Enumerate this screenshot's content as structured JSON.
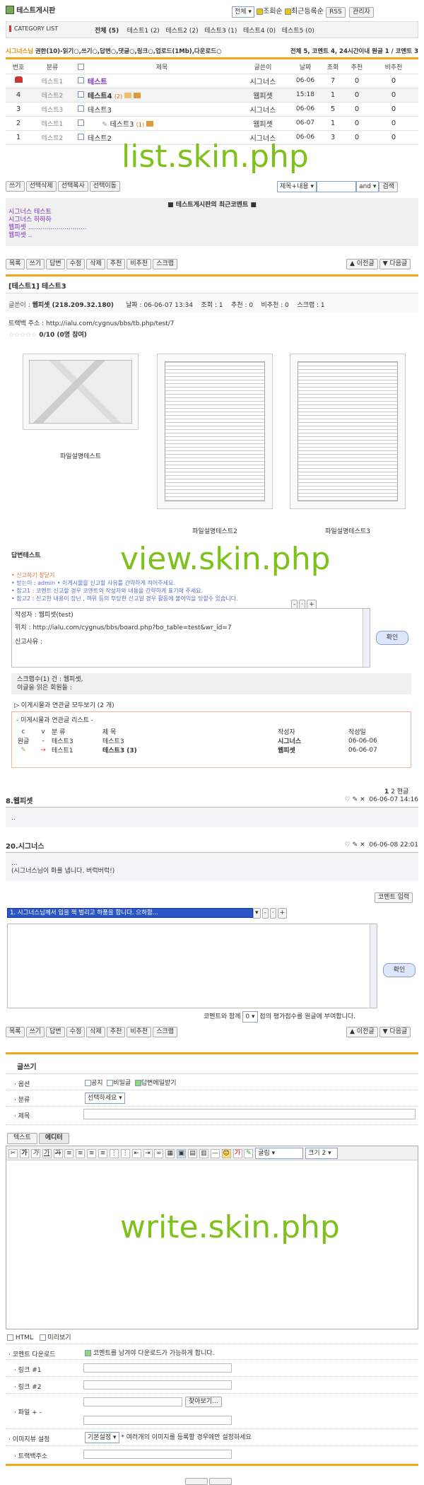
{
  "board": {
    "title": "테스트게시판",
    "scope_select": "전체",
    "latest_post": "조회순",
    "latest_reg": "최근등록순",
    "rss": "RSS",
    "admin": "관리자"
  },
  "category": {
    "label": "CATEGORY LIST",
    "items": [
      "전체 (5)",
      "테스트1 (2)",
      "테스트2 (2)",
      "테스트3 (1)",
      "테스트4 (0)",
      "테스트5 (0)"
    ]
  },
  "member_bar": {
    "name": "시그너스님",
    "perms": "권한(10)-읽기○,쓰기○,답변○,댓글○,링크○,업로드(1Mb),다운로드○",
    "stats": "전체 5, 코멘트 4,  24시간이내 원글 1 / 코멘트 3"
  },
  "list": {
    "headers": [
      "번호",
      "분류",
      "",
      "제목",
      "글쓴이",
      "날짜",
      "조회",
      "추천",
      "비추천"
    ],
    "rows": [
      {
        "num": "",
        "cat": "테스트1",
        "title": "테스트",
        "writer": "시그너스",
        "date": "06-06",
        "hit": "7",
        "good": "0",
        "bad": "0",
        "notice": true
      },
      {
        "num": "4",
        "cat": "테스트2",
        "title": "테스트4",
        "extra": "(2)",
        "writer": "웹피셋",
        "date": "15:18",
        "hit": "1",
        "good": "0",
        "bad": "0"
      },
      {
        "num": "3",
        "cat": "테스트3",
        "title": "테스트3",
        "extra": "",
        "writer": "시그너스",
        "date": "06-06",
        "hit": "5",
        "good": "0",
        "bad": "0"
      },
      {
        "num": "2",
        "cat": "테스트1",
        "title": "테스트3",
        "extra": "(1)",
        "writer": "웹피셋",
        "date": "06-07",
        "hit": "1",
        "good": "0",
        "bad": "0"
      },
      {
        "num": "1",
        "cat": "테스트2",
        "title": "테스트2",
        "extra": "",
        "writer": "시그너스",
        "date": "06-06",
        "hit": "3",
        "good": "0",
        "bad": "0"
      }
    ]
  },
  "labels": {
    "list": "list.skin.php",
    "view": "view.skin.php",
    "write": "write.skin.php"
  },
  "list_buttons": [
    "쓰기",
    "선택삭제",
    "선택복사",
    "선택이동"
  ],
  "search": {
    "field": "제목+내용",
    "op": "and",
    "go": "검색"
  },
  "recent": {
    "title": "테스트게시판의 최근코멘트",
    "lines": [
      "시그너스 테스트",
      "시그너스 하하하",
      "웹피셋 .............................",
      "웹피셋 .."
    ]
  },
  "view_buttons": [
    "목록",
    "쓰기",
    "답변",
    "수정",
    "삭제",
    "추천",
    "비추천",
    "스크랩"
  ],
  "nav": {
    "prev": "이전글",
    "next": "다음글"
  },
  "post": {
    "title": "[테스트1] 테스트3",
    "writer_lbl": "글쓴이 :",
    "writer": "웹피셋 (218.209.32.180)",
    "date": "날짜 : 06-06-07 13:34",
    "hit": "조회 : 1",
    "good": "추천 : 0",
    "bad": "비추천 : 0",
    "scrap": "스크랩 : 1",
    "trackback": "트랙백 주소 : http://ialu.com/cygnus/bbs/tb.php/test/7",
    "rating": "0/10 (0명 참여)",
    "files": [
      "파일설명테스트",
      "파일설명테스트2",
      "파일설명테스트3"
    ],
    "body": "답변테스트"
  },
  "report": {
    "lines": [
      "• 신고하기 창닫기",
      "• 받는이 : admin • 이게시물을 신고할 사유를 간략하게 적어주세요.",
      "• 참고1 : 코멘트 신고할 경우 코멘트의 작성자와 내용을 간략하게 표기해 주세요.",
      "• 참고2 : 신고한 내용이 장난 , 허위 등의 부당한 신고일 경우 활동에 불이익을 당할수 있습니다."
    ],
    "text1": "작성자 : 웹피셋(test)",
    "text2": "위치 : http://ialu.com/cygnus/bbs/board.php?bo_table=test&wr_id=7",
    "text3": "신고사유 :",
    "ok": "확인"
  },
  "scrap_box": {
    "l1": "스크랩수(1) 건 : 웹피셋,",
    "l2": "이글을 읽은 회원들 :"
  },
  "related": {
    "toggle": "▷ 이게시물과 연관글 모두보기 (2 개)",
    "title": "- 이게시물과 연관글 리스트 -",
    "headers": [
      "c",
      "v",
      "분 류",
      "제 목",
      "작성자",
      "작성일"
    ],
    "rows": [
      {
        "c": "원글",
        "v": "-",
        "cat": "테스트3",
        "title": "테스트3",
        "writer": "시그너스",
        "date": "06-06-06"
      },
      {
        "c": "",
        "v": "→",
        "cat": "테스트1",
        "title": "테스트3 (3)",
        "writer": "웹피셋",
        "date": "06-06-07"
      }
    ]
  },
  "paging": {
    "p1": "1",
    "p2": "2",
    "cur": "현글"
  },
  "comments": [
    {
      "name": "8.웹피셋",
      "date": "06-06-07 14:16",
      "text": ".."
    },
    {
      "name": "20.시그너스",
      "date": "06-06-08 22:01",
      "text": "...",
      "text2": "(시그너스님이 화를 냅니다. 버럭버럭!)"
    }
  ],
  "comment_form": {
    "btn": "코멘트 입력",
    "emo": "1. 시그너스님께서 입을 쩍 벌리고 하품을 합니다. 으하함...",
    "ok": "확인",
    "point_pre": "코멘트와 함께",
    "point": "0",
    "point_post": "점의 평가점수를 원글에 부여합니다."
  },
  "write": {
    "heading": "글쓰기",
    "opt_lbl": "옵션",
    "opts": [
      "공지",
      "비밀글",
      "답변메일받기"
    ],
    "cat_lbl": "분류",
    "cat_sel": "선택하세요",
    "subj_lbl": "제목",
    "tabs": [
      "텍스트",
      "에디터"
    ],
    "font_sel": "굴림",
    "size_sel": "크기 2",
    "html_lbl": "HTML",
    "preview_lbl": "미리보기",
    "dl_lbl": "코멘트 다운로드",
    "dl_text": "코멘트를 남겨야 다운로드가 가능하게 합니다.",
    "link1": "링크 #1",
    "link2": "링크 #2",
    "file_lbl": "파일 + -",
    "find": "찾아보기...",
    "imgview": "이미지뷰 설정",
    "imgview_sel": "기본설정",
    "imgview_note": "* 여러개의 이미지를 등록할 경우에만 설정하세요",
    "tb": "트랙백주소"
  }
}
